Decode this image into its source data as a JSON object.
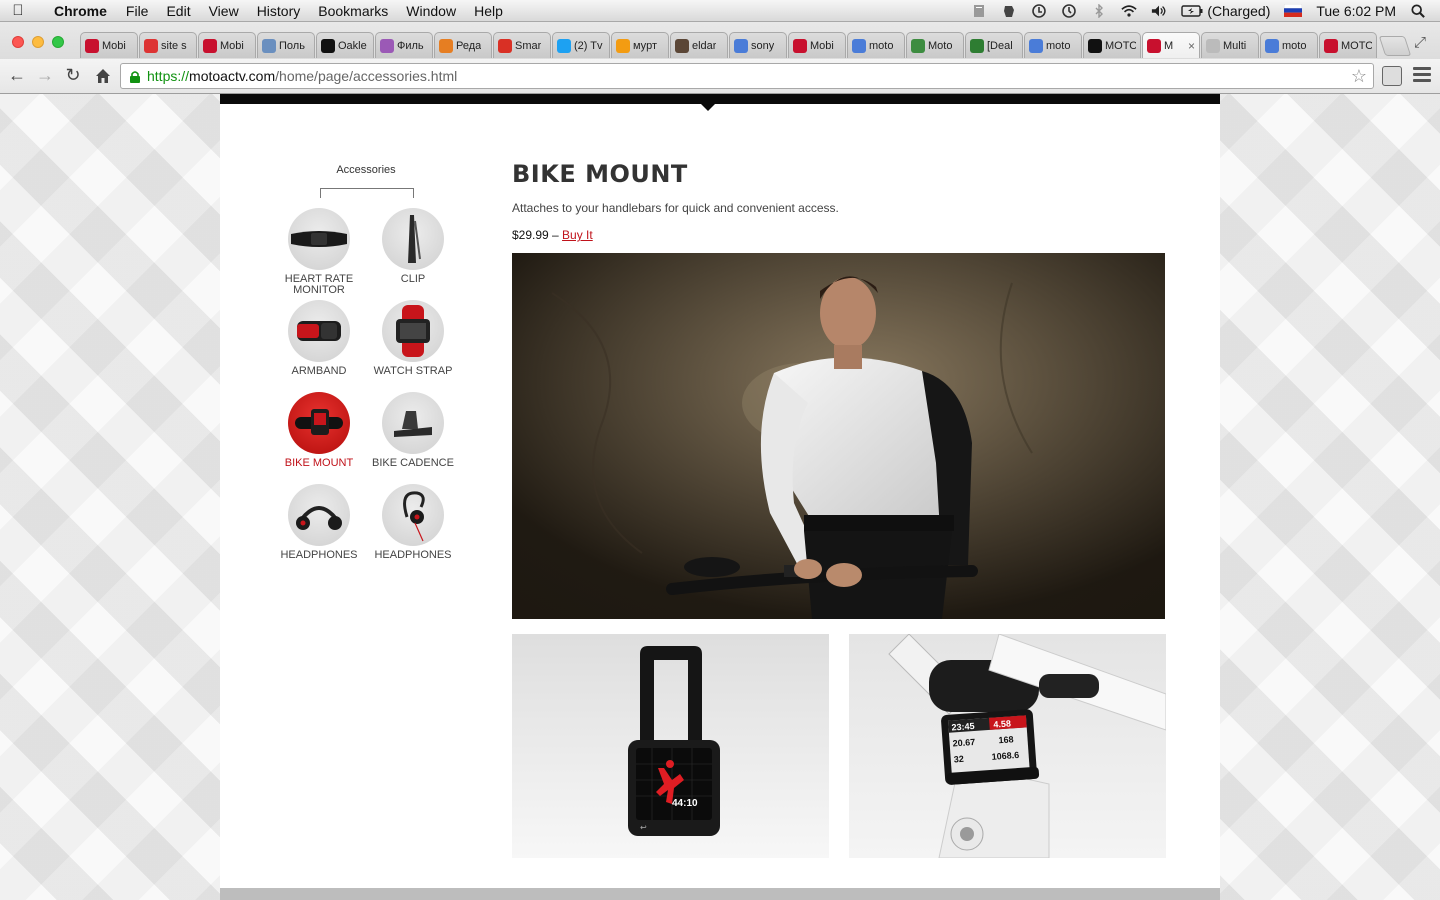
{
  "menubar": {
    "app_name": "Chrome",
    "menus": [
      "File",
      "Edit",
      "View",
      "History",
      "Bookmarks",
      "Window",
      "Help"
    ],
    "battery_status": "(Charged)",
    "clock": "Tue 6:02 PM"
  },
  "tabs": [
    {
      "title": "Mobi",
      "icon": "motorola-red",
      "color": "#c8102e"
    },
    {
      "title": "site s",
      "icon": "chart-icon",
      "color": "#d33"
    },
    {
      "title": "Mobi",
      "icon": "motorola-red",
      "color": "#c8102e"
    },
    {
      "title": "Поль",
      "icon": "tv-icon",
      "color": "#6a8fbf"
    },
    {
      "title": "Oakle",
      "icon": "oakley-icon",
      "color": "#111"
    },
    {
      "title": "Филь",
      "icon": "film-icon",
      "color": "#9b59b6"
    },
    {
      "title": "Реда",
      "icon": "edit-icon",
      "color": "#e67e22"
    },
    {
      "title": "Smar",
      "icon": "gmail-icon",
      "color": "#d93025"
    },
    {
      "title": "(2) Tv",
      "icon": "twitter-icon",
      "color": "#1da1f2"
    },
    {
      "title": "мурт",
      "icon": "blogger-icon",
      "color": "#f39c12"
    },
    {
      "title": "eldar",
      "icon": "instagram-icon",
      "color": "#5b4636"
    },
    {
      "title": "sony",
      "icon": "google-icon",
      "color": "#4a7cd8"
    },
    {
      "title": "Mobi",
      "icon": "motorola-red",
      "color": "#c8102e"
    },
    {
      "title": "moto",
      "icon": "google-icon",
      "color": "#4a7cd8"
    },
    {
      "title": "Moto",
      "icon": "globe-icon",
      "color": "#3d8c40"
    },
    {
      "title": "[Deal",
      "icon": "deal-icon",
      "color": "#2e7d32"
    },
    {
      "title": "moto",
      "icon": "google-icon",
      "color": "#4a7cd8"
    },
    {
      "title": "MOTO",
      "icon": "motorola-black",
      "color": "#111"
    },
    {
      "title": "M",
      "icon": "motorola-red",
      "color": "#c8102e",
      "active": true
    },
    {
      "title": "Multi",
      "icon": "page-icon",
      "color": "#bbb"
    },
    {
      "title": "moto",
      "icon": "google-icon",
      "color": "#4a7cd8"
    },
    {
      "title": "MOTO",
      "icon": "motorola-red",
      "color": "#c8102e"
    }
  ],
  "active_tab_close": "×",
  "address_bar": {
    "scheme": "https://",
    "host": "motoactv.com",
    "path": "/home/page/accessories.html"
  },
  "sidebar": {
    "heading": "Accessories",
    "items": [
      {
        "label_line1": "HEART RATE",
        "label_line2": "MONITOR",
        "icon": "heart-rate-monitor-icon"
      },
      {
        "label_line1": "CLIP",
        "label_line2": "",
        "icon": "clip-icon"
      },
      {
        "label_line1": "ARMBAND",
        "label_line2": "",
        "icon": "armband-icon"
      },
      {
        "label_line1": "WATCH STRAP",
        "label_line2": "",
        "icon": "watch-strap-icon"
      },
      {
        "label_line1": "BIKE MOUNT",
        "label_line2": "",
        "icon": "bike-mount-icon",
        "active": true
      },
      {
        "label_line1": "BIKE CADENCE",
        "label_line2": "",
        "icon": "bike-cadence-icon"
      },
      {
        "label_line1": "HEADPHONES",
        "label_line2": "",
        "icon": "headphones-icon"
      },
      {
        "label_line1": "HEADPHONES",
        "label_line2": "",
        "icon": "earbud-headphones-icon"
      }
    ]
  },
  "product": {
    "title": "BIKE MOUNT",
    "description": "Attaches to your handlebars for quick and convenient access.",
    "price": "$29.99",
    "price_separator": " – ",
    "buy_label": "Buy It"
  },
  "device_screen": {
    "time": "44:10"
  },
  "bike_screen": {
    "top_left": "23:45",
    "top_right": "4.58",
    "mid_left": "20.67",
    "mid_right": "168",
    "bottom_left": "32",
    "bottom_right": "1068.6"
  },
  "colors": {
    "accent_red": "#c0121a",
    "secure_green": "#119211",
    "page_bar": "#0a0a0a"
  }
}
